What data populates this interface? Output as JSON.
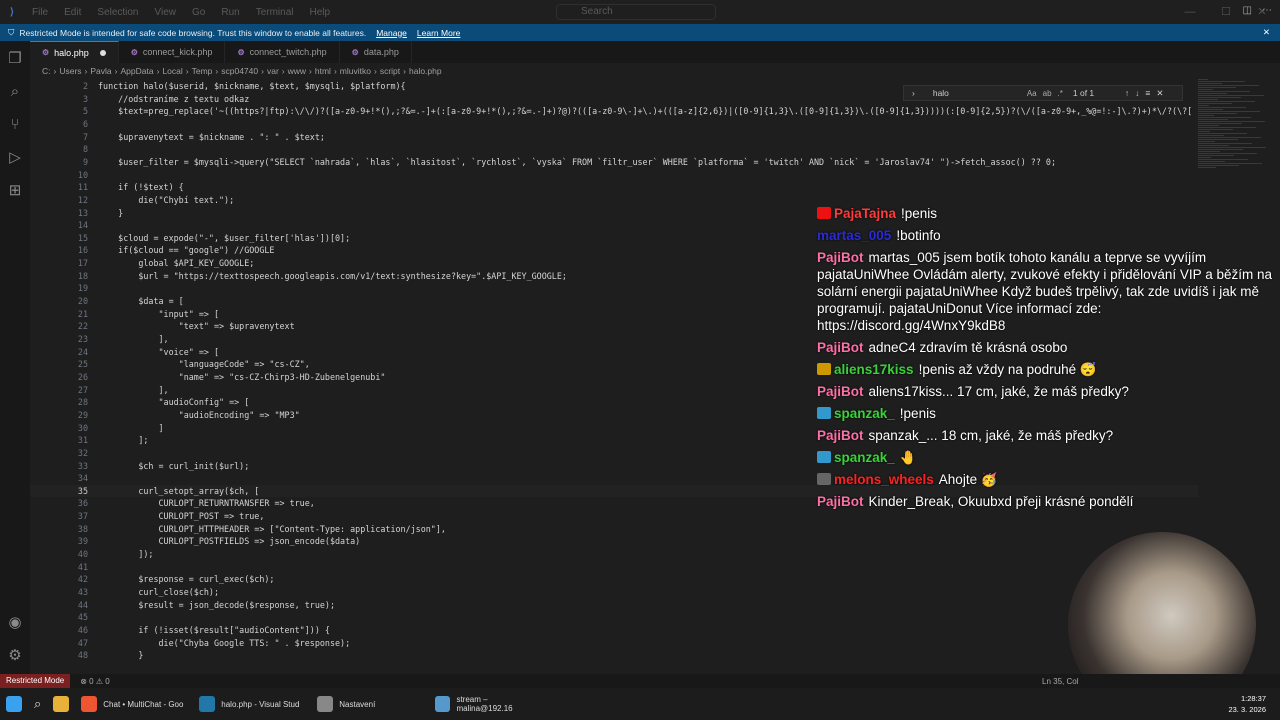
{
  "titlebar": {
    "menu": [
      "File",
      "Edit",
      "Selection",
      "View",
      "Go",
      "Run",
      "Terminal",
      "Help"
    ],
    "search": "Search"
  },
  "restricted": {
    "text": "Restricted Mode is intended for safe code browsing. Trust this window to enable all features.",
    "manage": "Manage",
    "learn": "Learn More"
  },
  "tabs": [
    {
      "label": "halo.php",
      "active": true
    },
    {
      "label": "connect_kick.php"
    },
    {
      "label": "connect_twitch.php"
    },
    {
      "label": "data.php"
    }
  ],
  "breadcrumb": [
    "C:",
    "Users",
    "Pavla",
    "AppData",
    "Local",
    "Temp",
    "scp04740",
    "var",
    "www",
    "html",
    "mluvitko",
    "script",
    "halo.php"
  ],
  "find": {
    "query": "halo",
    "count": "1 of 1"
  },
  "code": [
    {
      "n": "2",
      "t": "function halo($userid, $nickname, $text, $mysqli, $platform){"
    },
    {
      "n": "3",
      "t": "    //odstraníme z textu odkaz"
    },
    {
      "n": "5",
      "t": "    $text=preg_replace('~((https?|ftp):\\/\\/)?([a-z0-9+!*(),;?&=.-]+(:[a-z0-9+!*(),;?&=.-]+)?@)?(([a-z0-9\\-]+\\.)+(([a-z]{2,6})|([0-9]{1,3}\\.([0-9]{1,3})\\.([0-9]{1,3}))))(:[0-9]{2,5})?(\\/([a-z0-9+,_%@=!:-]\\.?)+)*\\/?(\\?["
    },
    {
      "n": "6",
      "t": ""
    },
    {
      "n": "7",
      "t": "    $upravenytext = $nickname . \": \" . $text;"
    },
    {
      "n": "8",
      "t": ""
    },
    {
      "n": "9",
      "t": "    $user_filter = $mysqli->query(\"SELECT `nahrada`, `hlas`, `hlasitost`, `rychlost`, `vyska` FROM `filtr_user` WHERE `platforma` = 'twitch' AND `nick` = 'Jaroslav74' \")->fetch_assoc() ?? 0;"
    },
    {
      "n": "10",
      "t": ""
    },
    {
      "n": "11",
      "t": "    if (!$text) {"
    },
    {
      "n": "12",
      "t": "        die(\"Chybí text.\");"
    },
    {
      "n": "13",
      "t": "    }"
    },
    {
      "n": "14",
      "t": ""
    },
    {
      "n": "15",
      "t": "    $cloud = expode(\"-\", $user_filter['hlas'])[0];"
    },
    {
      "n": "16",
      "t": "    if($cloud == \"google\") //GOOGLE"
    },
    {
      "n": "17",
      "t": "        global $API_KEY_GOOGLE;"
    },
    {
      "n": "18",
      "t": "        $url = \"https://texttospeech.googleapis.com/v1/text:synthesize?key=\".$API_KEY_GOOGLE;"
    },
    {
      "n": "19",
      "t": ""
    },
    {
      "n": "20",
      "t": "        $data = ["
    },
    {
      "n": "21",
      "t": "            \"input\" => ["
    },
    {
      "n": "22",
      "t": "                \"text\" => $upravenytext"
    },
    {
      "n": "23",
      "t": "            ],"
    },
    {
      "n": "24",
      "t": "            \"voice\" => ["
    },
    {
      "n": "25",
      "t": "                \"languageCode\" => \"cs-CZ\","
    },
    {
      "n": "26",
      "t": "                \"name\" => \"cs-CZ-Chirp3-HD-Zubenelgenubi\""
    },
    {
      "n": "27",
      "t": "            ],"
    },
    {
      "n": "28",
      "t": "            \"audioConfig\" => ["
    },
    {
      "n": "29",
      "t": "                \"audioEncoding\" => \"MP3\""
    },
    {
      "n": "30",
      "t": "            ]"
    },
    {
      "n": "31",
      "t": "        ];"
    },
    {
      "n": "32",
      "t": ""
    },
    {
      "n": "33",
      "t": "        $ch = curl_init($url);"
    },
    {
      "n": "34",
      "t": ""
    },
    {
      "n": "35",
      "t": "        curl_setopt_array($ch, ["
    },
    {
      "n": "36",
      "t": "            CURLOPT_RETURNTRANSFER => true,"
    },
    {
      "n": "37",
      "t": "            CURLOPT_POST => true,"
    },
    {
      "n": "38",
      "t": "            CURLOPT_HTTPHEADER => [\"Content-Type: application/json\"],"
    },
    {
      "n": "39",
      "t": "            CURLOPT_POSTFIELDS => json_encode($data)"
    },
    {
      "n": "40",
      "t": "        ]);"
    },
    {
      "n": "41",
      "t": ""
    },
    {
      "n": "42",
      "t": "        $response = curl_exec($ch);"
    },
    {
      "n": "43",
      "t": "        curl_close($ch);"
    },
    {
      "n": "44",
      "t": "        $result = json_decode($response, true);"
    },
    {
      "n": "45",
      "t": ""
    },
    {
      "n": "46",
      "t": "        if (!isset($result[\"audioContent\"])) {"
    },
    {
      "n": "47",
      "t": "            die(\"Chyba Google TTS: \" . $response);"
    },
    {
      "n": "48",
      "t": "        }"
    }
  ],
  "chat": [
    {
      "user": "PajaTajna",
      "color": "#ff3b3b",
      "badge": "#e11",
      "text": "!penis"
    },
    {
      "user": "martas_005",
      "color": "#2b2bd6",
      "badge": "",
      "text": "!botinfo"
    },
    {
      "user": "PajiBot",
      "color": "#ff6fa5",
      "badge": "",
      "text": "martas_005 jsem botík tohoto kanálu a teprve se vyvíjím pajataUniWhee Ovládám alerty, zvukové efekty i přidělování VIP a běžím na solární energii pajataUniWhee Když budeš trpělivý, tak zde uvidíš i jak mě programují. pajataUniDonut Více informací zde: https://discord.gg/4WnxY9kdB8"
    },
    {
      "user": "PajiBot",
      "color": "#ff6fa5",
      "badge": "",
      "text": "adneC4 zdravím tě krásná osobo"
    },
    {
      "user": "aliens17kiss",
      "color": "#3ad13a",
      "badge": "#c90",
      "text": "!penis až vždy na podruhé 😴"
    },
    {
      "user": "PajiBot",
      "color": "#ff6fa5",
      "badge": "",
      "text": "aliens17kiss... 17 cm, jaké, že máš předky?"
    },
    {
      "user": "spanzak_",
      "color": "#3ad13a",
      "badge": "#39c",
      "text": "!penis"
    },
    {
      "user": "PajiBot",
      "color": "#ff6fa5",
      "badge": "",
      "text": "spanzak_... 18 cm, jaké, že máš předky?"
    },
    {
      "user": "spanzak_",
      "color": "#3ad13a",
      "badge": "#39c",
      "text": "🤚"
    },
    {
      "user": "melons_wheels",
      "color": "#ff2222",
      "badge": "#666",
      "text": "Ahojte 🥳"
    },
    {
      "user": "PajiBot",
      "color": "#ff6fa5",
      "badge": "",
      "text": "Kinder_Break, Okuubxd přeji krásné pondělí"
    }
  ],
  "statusbar": {
    "mode": "Restricted Mode",
    "errors": "⊗ 0 ⚠ 0",
    "position": "Ln 35, Col"
  },
  "taskbar": [
    {
      "label": "Chat • MultiChat - Goo",
      "color": "#e53"
    },
    {
      "label": "halo.php - Visual Stud",
      "color": "#27a"
    },
    {
      "label": "Nastavení",
      "color": "#888"
    },
    {
      "label": "stream – malina@192.16",
      "color": "#59c"
    }
  ],
  "clock": {
    "time": "1:28:37",
    "date": "23. 3. 2026"
  }
}
